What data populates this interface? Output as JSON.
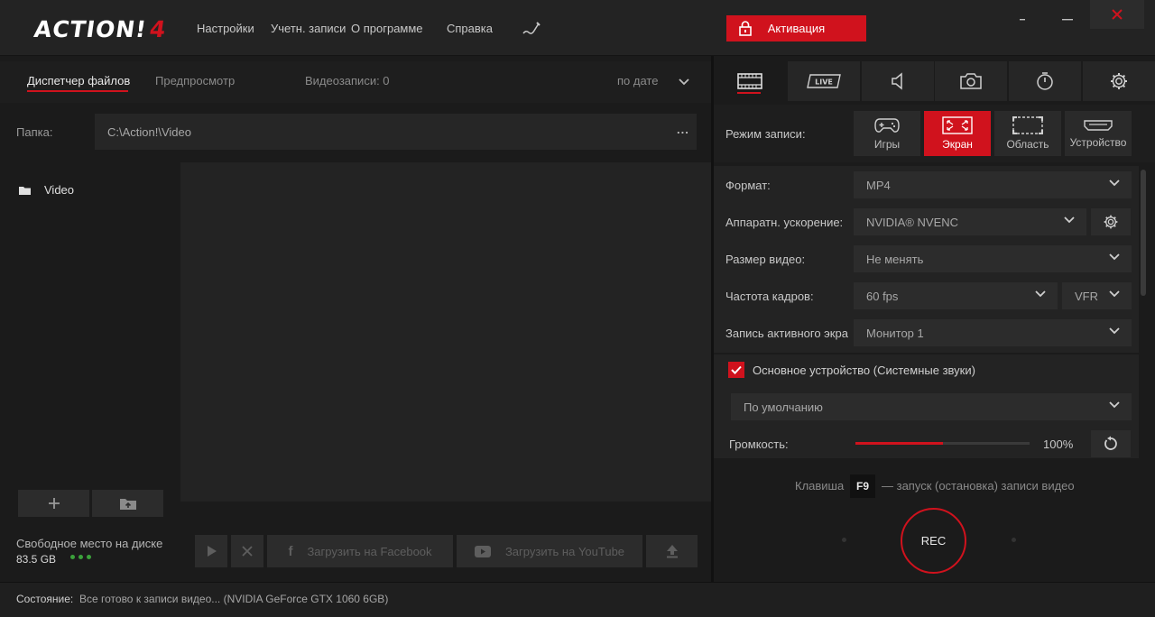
{
  "app": {
    "logo_text": "ACTION!",
    "logo_version": "4",
    "accent_color": "#d0121d"
  },
  "menu": {
    "settings": "Настройки",
    "accounts": "Учетн. записи",
    "about": "О программе",
    "help": "Справка",
    "activate": "Активация"
  },
  "window_controls": {
    "minimize": "-",
    "maximize": "-",
    "close": "✕"
  },
  "files": {
    "tab_files": "Диспетчер файлов",
    "tab_preview": "Предпросмотр",
    "video_count": "Видеозаписи: 0",
    "sort": "по дате",
    "folder_label": "Папка:",
    "folder_path": "C:\\Action!\\Video",
    "folder_more": "...",
    "tree_item": "Video",
    "free_space_label": "Свободное место на диске",
    "free_space_value": "83.5 GB",
    "upload_facebook": "Загрузить на Facebook",
    "upload_youtube": "Загрузить на YouTube"
  },
  "record": {
    "tabs": [
      "video-tab",
      "live-tab",
      "audio-tab",
      "screenshot-tab",
      "timer-tab",
      "settings-tab"
    ],
    "live_badge": "LIVE",
    "mode_label": "Режим записи:",
    "modes": [
      "Игры",
      "Экран",
      "Область",
      "Устройство"
    ],
    "active_mode": "Экран",
    "format_label": "Формат:",
    "format_value": "MP4",
    "hw_label": "Аппаратн. ускорение:",
    "hw_value": "NVIDIA® NVENC",
    "size_label": "Размер видео:",
    "size_value": "Не менять",
    "fps_label": "Частота кадров:",
    "fps_value": "60 fps",
    "fps_mode": "VFR",
    "active_screen_label": "Запись активного экра",
    "active_screen_value": "Монитор 1",
    "audio_device_label": "Основное устройство (Системные звуки)",
    "audio_device_checked": true,
    "audio_device_value": "По умолчанию",
    "volume_label": "Громкость:",
    "volume_value": "100%",
    "volume_level": 0.5,
    "hotkey_pre": "Клавиша",
    "hotkey_key": "F9",
    "hotkey_post": "— запуск (остановка) записи видео",
    "rec_label": "REC"
  },
  "status": {
    "label": "Состояние:",
    "text": "Все готово к записи видео...  (NVIDIA GeForce GTX 1060 6GB)"
  }
}
